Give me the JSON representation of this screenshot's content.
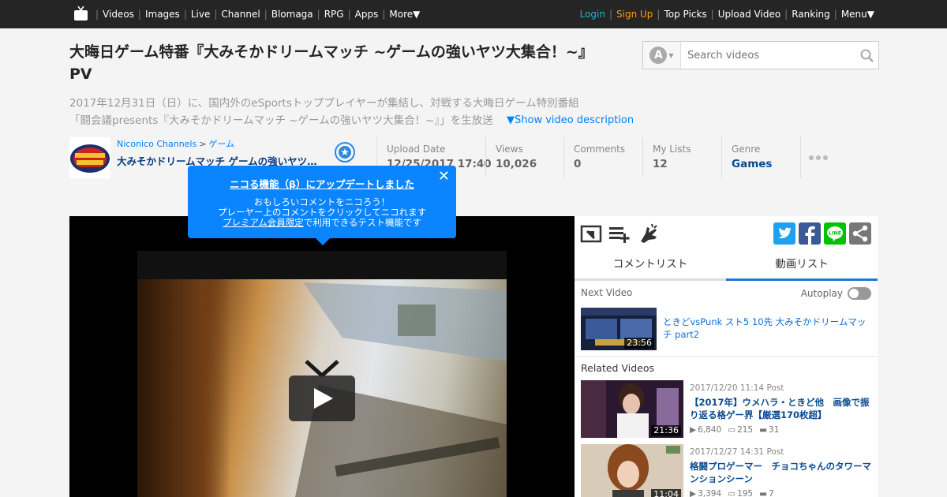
{
  "nav": {
    "left": [
      "Videos",
      "Images",
      "Live",
      "Channel",
      "Blomaga",
      "RPG",
      "Apps",
      "More▼"
    ],
    "login": "Login",
    "signup": "Sign Up",
    "right": [
      "Top Picks",
      "Upload Video",
      "Ranking",
      "Menu▼"
    ]
  },
  "video": {
    "title": "大晦日ゲーム特番『大みそかドリームマッチ ~ゲームの強いヤツ大集合！~』PV",
    "desc_line1": "2017年12月31日（日）に、国内外のeSportsトッププレイヤーが集結し、対戦する大晦日ゲーム特別番組",
    "desc_line2": "「闘会議presents『大みそかドリームマッチ ~ゲームの強いヤツ大集合！~』」を生放送",
    "show_more": "▼Show video description"
  },
  "search": {
    "placeholder": "Search videos",
    "mode_letter": "A"
  },
  "channel": {
    "source": "Niconico Channels",
    "separator": ">",
    "category": "ゲーム",
    "name": "大みそかドリームマッチ ゲームの強いヤツ大集合！"
  },
  "stats": {
    "upload": {
      "label": "Upload Date",
      "value": "12/25/2017 17:40"
    },
    "views": {
      "label": "Views",
      "value": "10,026"
    },
    "comments": {
      "label": "Comments",
      "value": "0"
    },
    "mylists": {
      "label": "My Lists",
      "value": "12"
    },
    "genre": {
      "label": "Genre",
      "value": "Games"
    }
  },
  "popup": {
    "title": "ニコる機能（β）にアップデートしました",
    "line1": "おもしろいコメントをニコろう！",
    "line2": "プレーヤー上のコメントをクリックしてニコれます",
    "line3_link": "プレミアム会員限定",
    "line3_rest": "で利用できるテスト機能です",
    "close": "✕"
  },
  "panel": {
    "tabs": [
      "コメントリスト",
      "動画リスト"
    ],
    "active_tab": 1,
    "next_label": "Next Video",
    "autoplay_label": "Autoplay",
    "autoplay_on": false,
    "next_video": {
      "title": "ときどvsPunk スト5 10先 大みそかドリームマッチ part2",
      "duration": "23:56"
    },
    "related_label": "Related Videos",
    "related": [
      {
        "date": "2017/12/20 11:14 Post",
        "title": "【2017年】ウメハラ・ときど他　画像で振り返る格ゲー界【厳選170枚超】",
        "duration": "21:36",
        "views": "6,840",
        "comments": "215",
        "mylists": "31"
      },
      {
        "date": "2017/12/27 14:31 Post",
        "title": "格闘プロゲーマー　チョコちゃんのタワーマンションシーン",
        "duration": "11:04",
        "views": "3,394",
        "comments": "195",
        "mylists": "7"
      }
    ]
  },
  "colors": {
    "accent": "#0a84ff",
    "link": "#0080ff",
    "topbar": "#252525",
    "login": "#21b0d8",
    "signup": "#ff9f0a"
  },
  "icons": [
    "niconico-tv-icon",
    "search-icon",
    "follow-star-icon",
    "more-dots-icon",
    "play-icon",
    "save-clip-icon",
    "add-mylist-icon",
    "nicoru-hand-icon",
    "twitter-icon",
    "facebook-icon",
    "line-icon",
    "share-icon"
  ]
}
